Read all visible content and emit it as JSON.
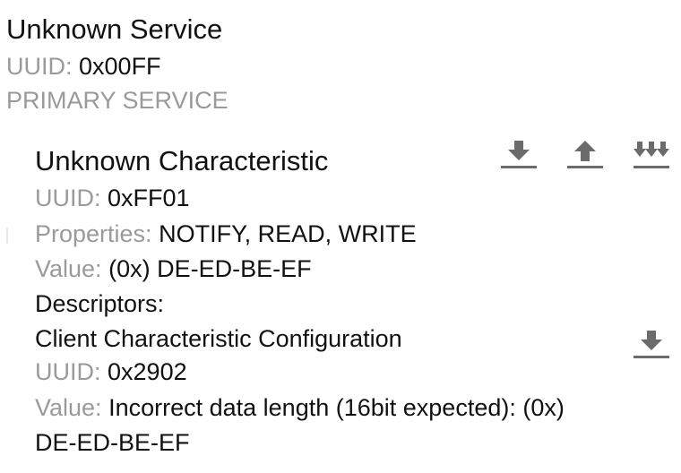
{
  "service": {
    "title": "Unknown Service",
    "uuid_label": "UUID:",
    "uuid_value": "0x00FF",
    "type": "PRIMARY SERVICE"
  },
  "characteristic": {
    "title": "Unknown Characteristic",
    "uuid_label": "UUID:",
    "uuid_value": "0xFF01",
    "properties_label": "Properties:",
    "properties_value": "NOTIFY, READ, WRITE",
    "value_label": "Value:",
    "value_value": "(0x) DE-ED-BE-EF",
    "actions": [
      "download-icon",
      "upload-icon",
      "notify-multi-download-icon"
    ]
  },
  "descriptors": {
    "heading": "Descriptors:",
    "items": [
      {
        "name": "Client Characteristic Configuration",
        "uuid_label": "UUID:",
        "uuid_value": "0x2902",
        "value_label": "Value:",
        "value_line1": "Incorrect data length (16bit expected): (0x)",
        "value_line2": "DE-ED-BE-EF",
        "action": "download-icon"
      }
    ]
  },
  "colors": {
    "primary_text": "#111111",
    "secondary_text": "#9a9a9a",
    "icon": "#6b6b6b"
  }
}
